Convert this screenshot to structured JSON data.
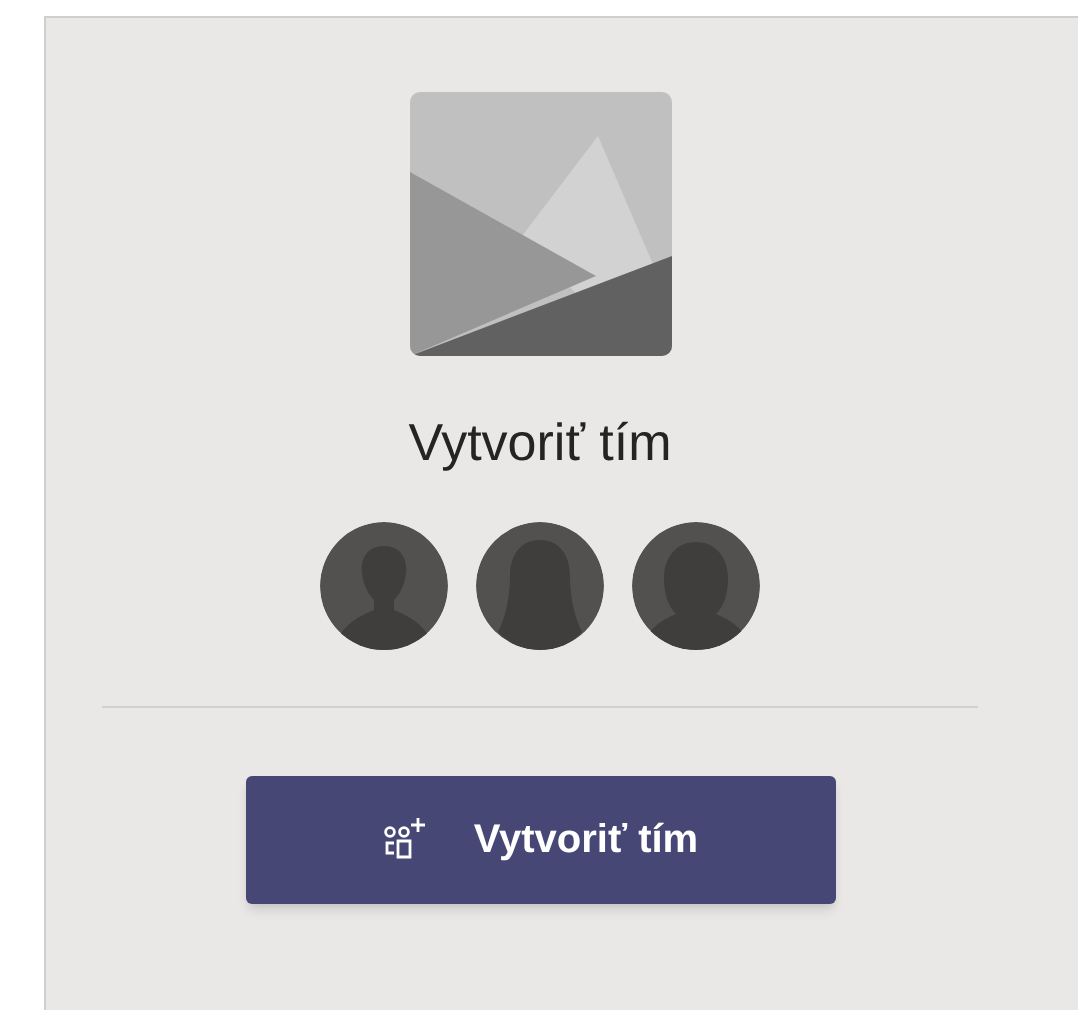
{
  "card": {
    "title": "Vytvoriť tím",
    "members": [
      {
        "kind": "short-hair"
      },
      {
        "kind": "long-hair"
      },
      {
        "kind": "bob-hair"
      }
    ],
    "button": {
      "label": "Vytvoriť tím"
    }
  }
}
